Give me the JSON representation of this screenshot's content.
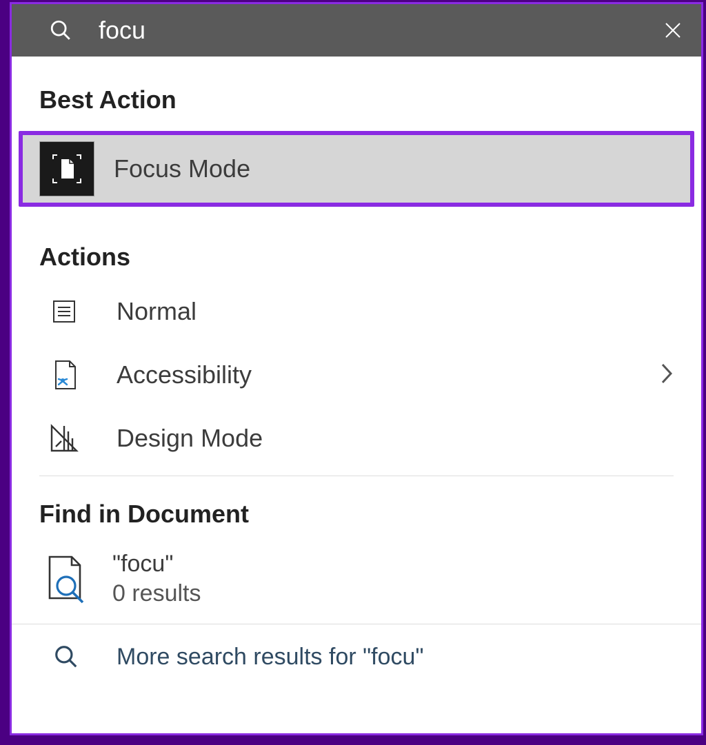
{
  "search": {
    "value": "focu"
  },
  "sections": {
    "best_action_heading": "Best Action",
    "actions_heading": "Actions",
    "find_heading": "Find in Document"
  },
  "best_action": {
    "label": "Focus Mode"
  },
  "actions": {
    "normal": "Normal",
    "accessibility": "Accessibility",
    "design_mode": "Design Mode"
  },
  "find": {
    "term": "\"focu\"",
    "results": "0 results"
  },
  "more": {
    "label": "More search results for \"focu\""
  }
}
